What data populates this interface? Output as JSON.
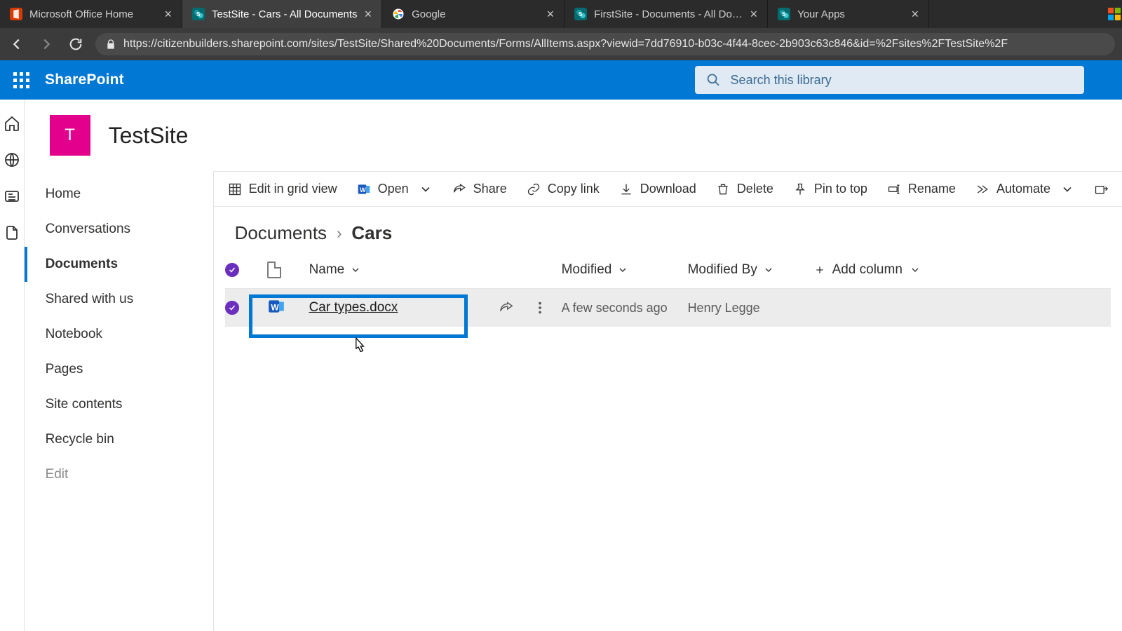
{
  "browser": {
    "tabs": [
      {
        "title": "Microsoft Office Home",
        "active": false
      },
      {
        "title": "TestSite - Cars - All Documents",
        "active": true
      },
      {
        "title": "Google",
        "active": false
      },
      {
        "title": "FirstSite - Documents - All Docu",
        "active": false
      },
      {
        "title": "Your Apps",
        "active": false
      }
    ],
    "url": "https://citizenbuilders.sharepoint.com/sites/TestSite/Shared%20Documents/Forms/AllItems.aspx?viewid=7dd76910-b03c-4f44-8cec-2b903c63c846&id=%2Fsites%2FTestSite%2F"
  },
  "suite": {
    "brand": "SharePoint",
    "search_placeholder": "Search this library"
  },
  "site": {
    "logo_letter": "T",
    "title": "TestSite"
  },
  "leftnav": {
    "items": [
      {
        "label": "Home"
      },
      {
        "label": "Conversations"
      },
      {
        "label": "Documents",
        "active": true
      },
      {
        "label": "Shared with us"
      },
      {
        "label": "Notebook"
      },
      {
        "label": "Pages"
      },
      {
        "label": "Site contents"
      },
      {
        "label": "Recycle bin"
      },
      {
        "label": "Edit",
        "muted": true
      }
    ]
  },
  "commands": {
    "edit_grid": "Edit in grid view",
    "open": "Open",
    "share": "Share",
    "copy_link": "Copy link",
    "download": "Download",
    "delete": "Delete",
    "pin": "Pin to top",
    "rename": "Rename",
    "automate": "Automate"
  },
  "breadcrumb": {
    "parent": "Documents",
    "current": "Cars"
  },
  "columns": {
    "name": "Name",
    "modified": "Modified",
    "modified_by": "Modified By",
    "add_column": "Add column"
  },
  "rows": [
    {
      "name": "Car types.docx",
      "modified": "A few seconds ago",
      "modified_by": "Henry Legge",
      "selected": true
    }
  ],
  "colors": {
    "accent": "#0078d4",
    "site_logo_bg": "#e3008c"
  }
}
